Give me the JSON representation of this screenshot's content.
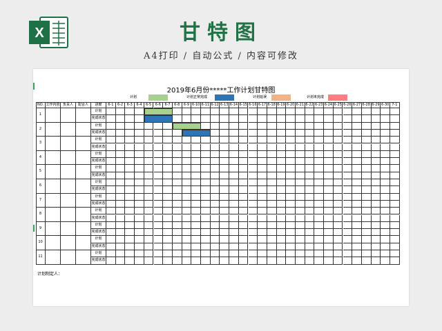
{
  "header": {
    "title": "甘特图",
    "subtitle": "A4打印 / 自动公式 / 内容可修改",
    "logo_letter": "X"
  },
  "sheet": {
    "title": "2019年6月份*****工作计划甘特图",
    "legend": [
      {
        "label": "计划",
        "color": "#a9d18e"
      },
      {
        "label": "计划正常完成",
        "color": "#2e75b6"
      },
      {
        "label": "计划延误",
        "color": "#f4b183"
      },
      {
        "label": "计划未完成",
        "color": "#ff7c80"
      }
    ],
    "columns": [
      "NO.",
      "工作内容",
      "负责人",
      "配合人",
      "进度"
    ],
    "dates": [
      "6-1",
      "6-2",
      "6-3",
      "6-4",
      "6-5",
      "6-6",
      "6-7",
      "6-8",
      "6-9",
      "6-10",
      "6-11",
      "6-12",
      "6-13",
      "6-14",
      "6-15",
      "6-16",
      "6-17",
      "6-18",
      "6-19",
      "6-20",
      "6-21",
      "6-22",
      "6-23",
      "6-24",
      "6-25",
      "6-26",
      "6-27",
      "6-28",
      "6-29",
      "6-30",
      "7-1"
    ],
    "row_types": [
      "计划",
      "完成状态"
    ],
    "rows": [
      "1",
      "2",
      "3",
      "4",
      "5",
      "6",
      "7",
      "8",
      "9",
      "10",
      "11"
    ],
    "bars": [
      {
        "row": 1,
        "type": "plan",
        "start": "6-5",
        "end": "6-7"
      },
      {
        "row": 1,
        "type": "done",
        "start": "6-5",
        "end": "6-7"
      },
      {
        "row": 2,
        "type": "plan",
        "start": "6-8",
        "end": "6-10"
      },
      {
        "row": 2,
        "type": "done",
        "start": "6-9",
        "end": "6-11"
      }
    ],
    "footer_label": "计划制定人："
  },
  "colors": {
    "brand_green": "#217346",
    "plan": "#a9d18e",
    "done": "#2e75b6",
    "grid_line": "#333333"
  }
}
